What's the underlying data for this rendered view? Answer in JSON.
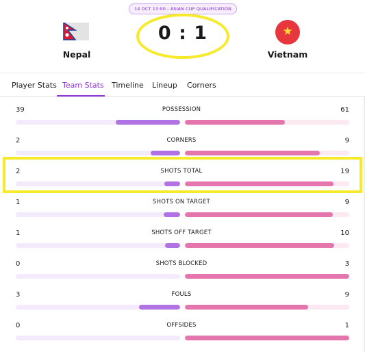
{
  "match": {
    "badge": "14 OCT 13:00 - ASIAN CUP QUALIFICATION",
    "score": "0 : 1",
    "home": {
      "name": "Nepal",
      "flag": "nepal-flag-icon"
    },
    "away": {
      "name": "Vietnam",
      "flag": "vietnam-flag-icon"
    }
  },
  "tabs": [
    {
      "label": "Player Stats",
      "active": false
    },
    {
      "label": "Team Stats",
      "active": true
    },
    {
      "label": "Timeline",
      "active": false
    },
    {
      "label": "Lineup",
      "active": false
    },
    {
      "label": "Corners",
      "active": false
    }
  ],
  "colors": {
    "accent": "#8a2fd0",
    "home_bar": "#b172e3",
    "away_bar": "#e576ad",
    "highlight": "#f7ea2b"
  },
  "stats": [
    {
      "label": "POSSESSION",
      "home": "39",
      "away": "61",
      "home_fill": 0.39,
      "away_fill": 0.61
    },
    {
      "label": "CORNERS",
      "home": "2",
      "away": "9",
      "home_fill": 0.18,
      "away_fill": 0.82
    },
    {
      "label": "SHOTS TOTAL",
      "home": "2",
      "away": "19",
      "home_fill": 0.095,
      "away_fill": 0.905,
      "highlighted": true
    },
    {
      "label": "SHOTS ON TARGET",
      "home": "1",
      "away": "9",
      "home_fill": 0.1,
      "away_fill": 0.9
    },
    {
      "label": "SHOTS OFF TARGET",
      "home": "1",
      "away": "10",
      "home_fill": 0.09,
      "away_fill": 0.91
    },
    {
      "label": "SHOTS BLOCKED",
      "home": "0",
      "away": "3",
      "home_fill": 0.0,
      "away_fill": 1.0
    },
    {
      "label": "FOULS",
      "home": "3",
      "away": "9",
      "home_fill": 0.25,
      "away_fill": 0.75
    },
    {
      "label": "OFFSIDES",
      "home": "0",
      "away": "1",
      "home_fill": 0.0,
      "away_fill": 1.0
    }
  ]
}
